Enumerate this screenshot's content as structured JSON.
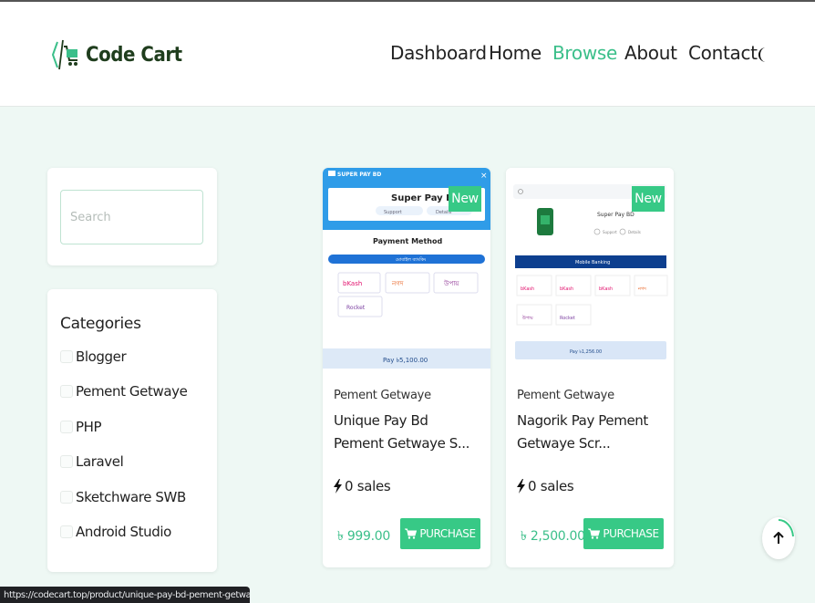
{
  "brand": {
    "name": "Code Cart",
    "logo_icon": "cart-code-icon"
  },
  "nav": {
    "items": [
      {
        "label": "Dashboard",
        "active": false
      },
      {
        "label": "Home",
        "active": false
      },
      {
        "label": "Browse",
        "active": true
      },
      {
        "label": "About",
        "active": false
      },
      {
        "label": "Contact",
        "active": false
      }
    ],
    "theme_icon": "moon-icon"
  },
  "sidebar": {
    "search": {
      "placeholder": "Search",
      "value": ""
    },
    "categories": {
      "title": "Categories",
      "items": [
        {
          "label": "Blogger",
          "checked": false
        },
        {
          "label": "Pement Getwaye",
          "checked": false
        },
        {
          "label": "PHP",
          "checked": false
        },
        {
          "label": "Laravel",
          "checked": false
        },
        {
          "label": "Sketchware SWB",
          "checked": false
        },
        {
          "label": "Android Studio",
          "checked": false
        }
      ]
    }
  },
  "products": [
    {
      "badge": "New",
      "category": "Pement Getwaye",
      "title": "Unique Pay Bd Pement Getwaye S...",
      "sales": "0 sales",
      "price": "৳ 999.00",
      "button": "PURCHASE",
      "thumb": {
        "header": "SUPER PAY BD",
        "app_name": "Super Pay BD",
        "chip1": "Support",
        "chip2": "Details",
        "section": "Payment Method",
        "bar": "মোবাইল ব্যাংকিং",
        "methods": [
          "bKash",
          "নগদ",
          "উপায়"
        ],
        "method4": "Rocket",
        "pay": "Pay ৳5,100.00"
      }
    },
    {
      "badge": "New",
      "category": "Pement Getwaye",
      "title": "Nagorik Pay Pement Getwaye Scr...",
      "sales": "0 sales",
      "price": "৳ 2,500.00",
      "button": "PURCHASE",
      "thumb": {
        "app_name": "Super Pay BD",
        "chip1": "Support",
        "chip2": "Details",
        "bar": "Mobile Banking",
        "methods": [
          "bKash",
          "bKash",
          "bKash",
          "নগদ"
        ],
        "row2": [
          "উপায়",
          "Rocket"
        ],
        "pay": "Pay ৳1,256.00"
      }
    }
  ],
  "status_bar": {
    "url": "https://codecart.top/product/unique-pay-bd-pement-getwaye-script/5"
  },
  "colors": {
    "accent": "#37c986",
    "background": "#eef8f4",
    "brand_dark": "#1f3d1d"
  }
}
